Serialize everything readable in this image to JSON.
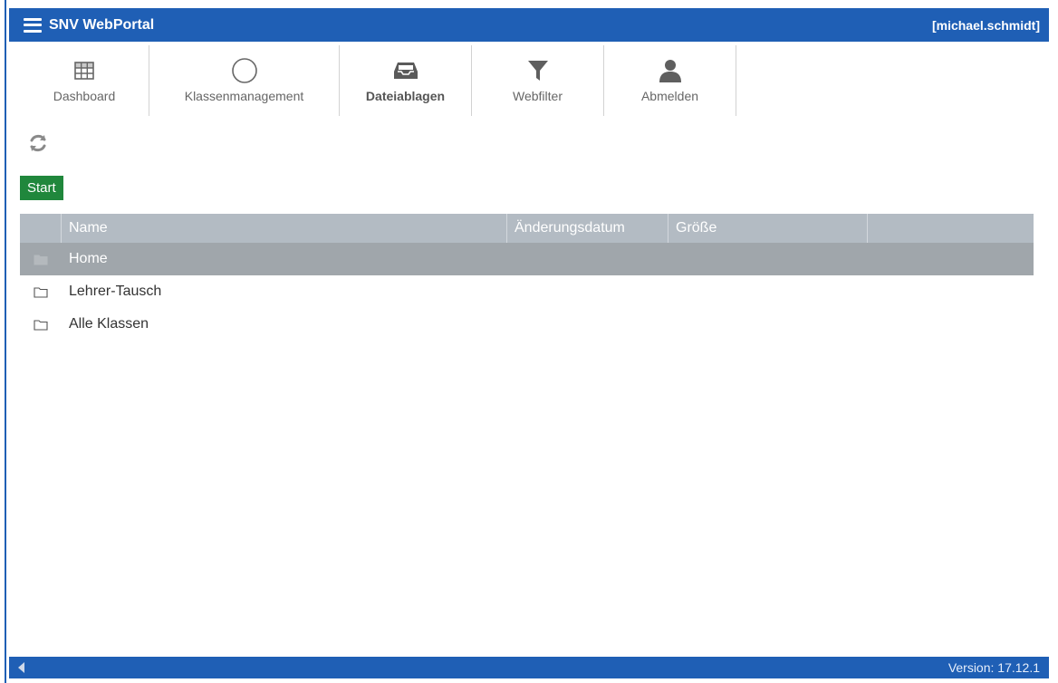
{
  "app": {
    "title": "SNV WebPortal",
    "user": "[michael.schmidt]"
  },
  "toolbar": {
    "items": [
      {
        "label": "Dashboard",
        "icon": "table-grid-icon"
      },
      {
        "label": "Klassenmanagement",
        "icon": "circle-icon"
      },
      {
        "label": "Dateiablagen",
        "icon": "inbox-tray-icon",
        "active": true
      },
      {
        "label": "Webfilter",
        "icon": "funnel-icon"
      },
      {
        "label": "Abmelden",
        "icon": "user-icon"
      }
    ]
  },
  "actions": {
    "refresh_icon": "refresh-icon",
    "start_label": "Start"
  },
  "table": {
    "columns": [
      "Name",
      "Änderungsdatum",
      "Größe"
    ],
    "rows": [
      {
        "name": "Home",
        "icon": "folder-icon",
        "selected": true
      },
      {
        "name": "Lehrer-Tausch",
        "icon": "folder-icon"
      },
      {
        "name": "Alle Klassen",
        "icon": "folder-icon"
      }
    ]
  },
  "status": {
    "version": "Version: 17.12.1"
  },
  "colors": {
    "brand_blue": "#1f5fb5",
    "start_green": "#20873c",
    "header_gray": "#b3bbc3",
    "selected_row": "#a0a6ab"
  }
}
